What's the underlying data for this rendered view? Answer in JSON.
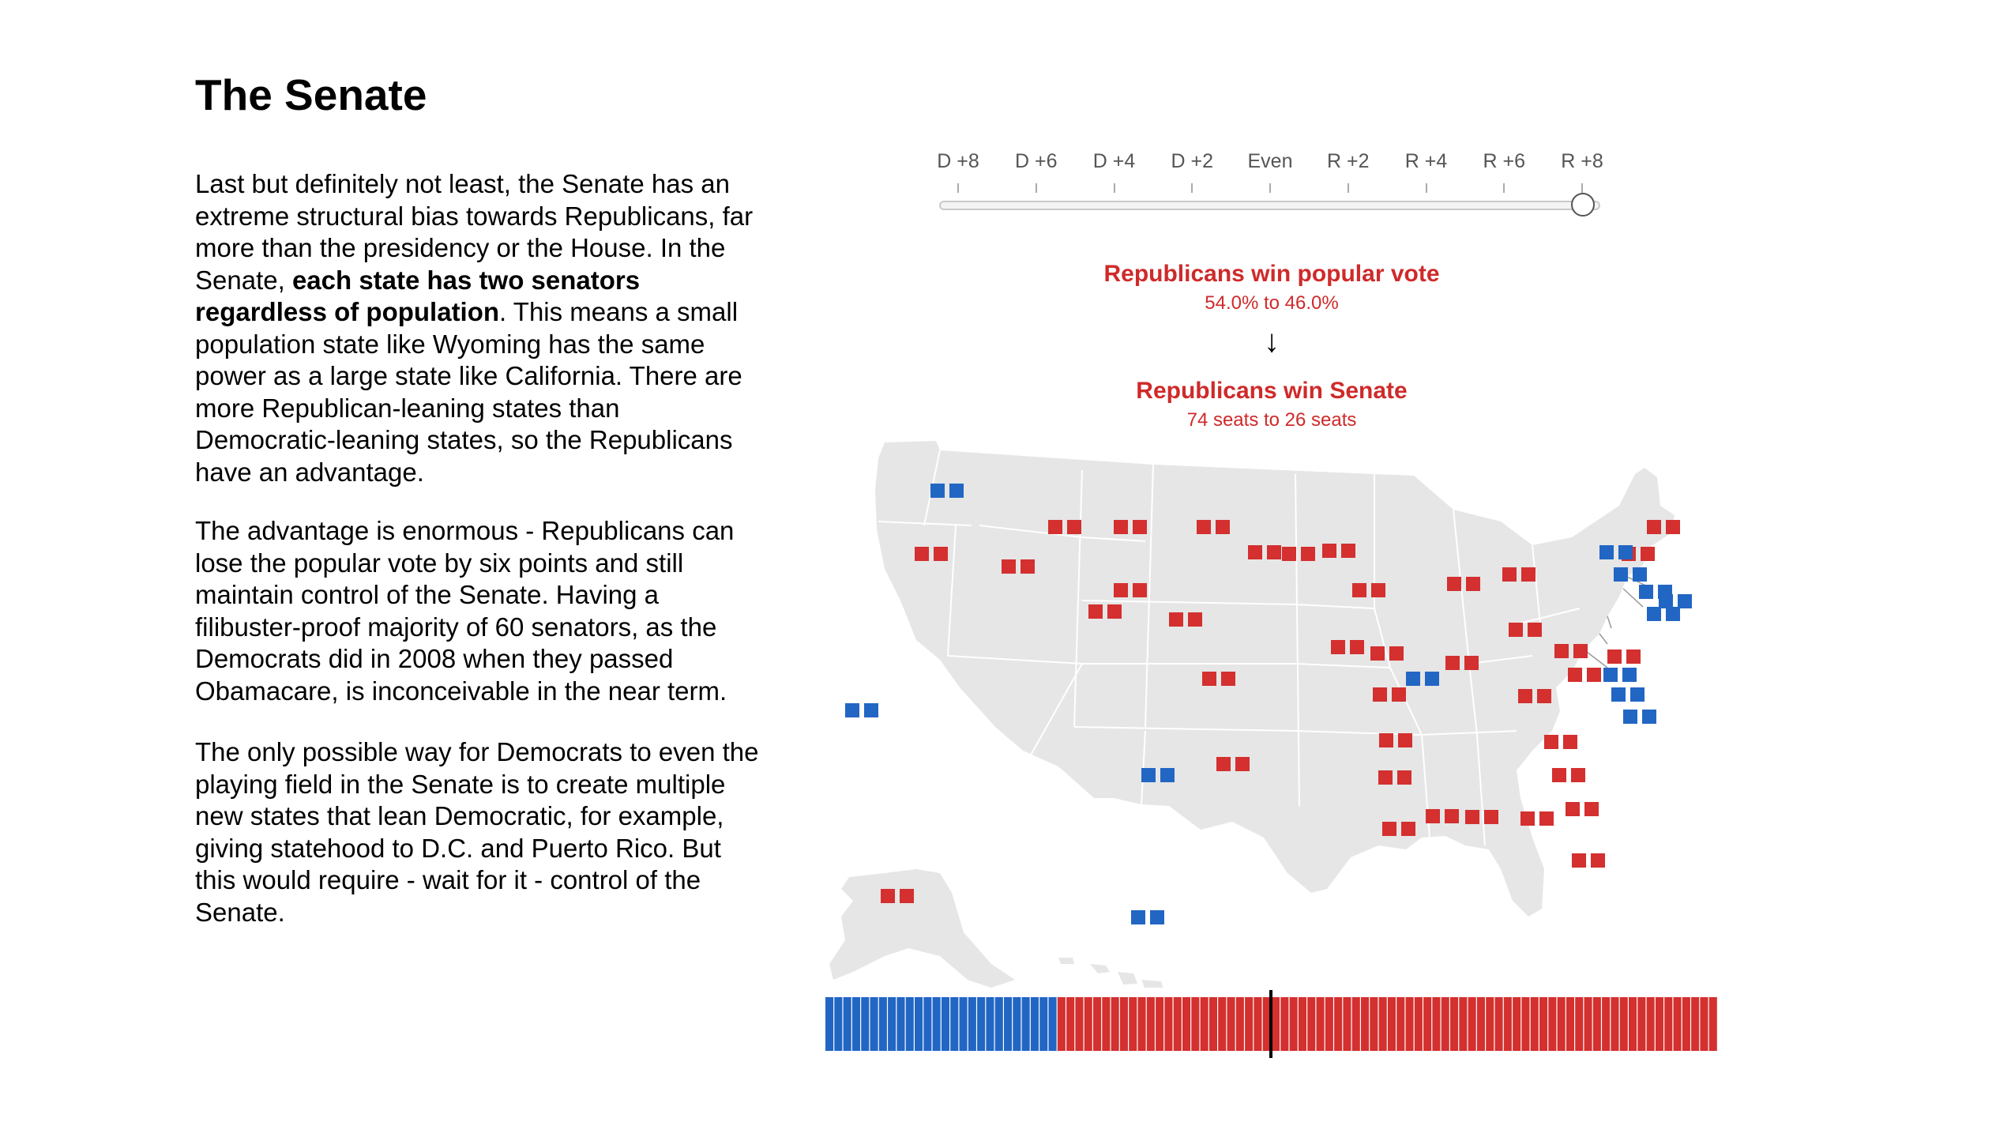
{
  "title": "The Senate",
  "paragraphs": {
    "p1_a": "Last but definitely not least, the Senate has an extreme structural bias towards Republicans, far more than the presidency or the House. In the Senate, ",
    "p1_bold": "each state has two senators regardless of population",
    "p1_b": ". This means a small population state like Wyoming has the same power as a large state like California. There are more Republican-leaning states than Democratic-leaning states, so the Republicans have an advantage.",
    "p2": "The advantage is enormous - Republicans can lose the popular vote by six points and still maintain control of the Senate. Having a filibuster-proof majority of 60 senators, as the Democrats did in 2008 when they passed Obamacare, is inconceivable in the near term.",
    "p3": "The only possible way for Democrats to even the playing field in the Senate is to create multiple new states that lean Democratic, for example, giving statehood to D.C. and Puerto Rico. But this would require - wait for it - control of the Senate."
  },
  "slider": {
    "ticks": [
      "D +8",
      "D +6",
      "D +4",
      "D +2",
      "Even",
      "R +2",
      "R +4",
      "R +6",
      "R +8"
    ],
    "selected": "R +8",
    "value_index": 8
  },
  "popular_vote": {
    "headline": "Republicans win popular vote",
    "detail": "54.0% to 46.0%"
  },
  "arrow": "↓",
  "senate_outcome": {
    "headline": "Republicans win Senate",
    "detail": "74 seats to 26 seats"
  },
  "seats": {
    "democratic": 26,
    "republican": 74,
    "total": 100
  },
  "colors": {
    "democrat": "#2266c4",
    "republican": "#d3302f",
    "map_fill": "#e6e6e6",
    "text_red": "#cf2a2a"
  }
}
